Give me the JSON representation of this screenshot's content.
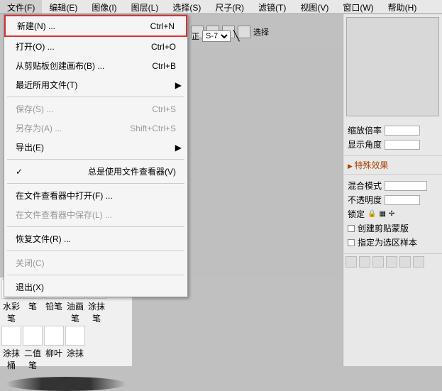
{
  "menubar": [
    {
      "label": "文件(F)"
    },
    {
      "label": "编辑(E)"
    },
    {
      "label": "图像(I)"
    },
    {
      "label": "图层(L)"
    },
    {
      "label": "选择(S)"
    },
    {
      "label": "尺子(R)"
    },
    {
      "label": "滤镜(T)"
    },
    {
      "label": "视图(V)"
    },
    {
      "label": "窗口(W)"
    },
    {
      "label": "帮助(H)"
    }
  ],
  "file_menu": {
    "new": {
      "label": "新建(N) ...",
      "shortcut": "Ctrl+N"
    },
    "open": {
      "label": "打开(O) ...",
      "shortcut": "Ctrl+O"
    },
    "clipboard": {
      "label": "从剪贴板创建画布(B) ...",
      "shortcut": "Ctrl+B"
    },
    "recent": {
      "label": "最近所用文件(T)"
    },
    "save": {
      "label": "保存(S) ...",
      "shortcut": "Ctrl+S"
    },
    "saveas": {
      "label": "另存为(A) ...",
      "shortcut": "Shift+Ctrl+S"
    },
    "export": {
      "label": "导出(E)"
    },
    "always_viewer": {
      "label": "总是使用文件查看器(V)"
    },
    "open_viewer": {
      "label": "在文件查看器中打开(F) ..."
    },
    "save_viewer": {
      "label": "在文件查看器中保存(L) ..."
    },
    "restore": {
      "label": "恢复文件(R) ..."
    },
    "close": {
      "label": "关闭(C)"
    },
    "exit": {
      "label": "退出(X)"
    }
  },
  "toolbar": {
    "select_label": "选择",
    "mode_label": "正",
    "seven_option": "S-7"
  },
  "right_panel": {
    "zoom_label": "缩放倍率",
    "angle_label": "显示角度",
    "effects_header": "特殊效果",
    "blend_label": "混合模式",
    "opacity_label": "不透明度",
    "lock_label": "锁定",
    "clip_label": "创建剪贴蒙版",
    "sample_label": "指定为选区样本"
  },
  "brushes": {
    "row1": [
      "水彩笔",
      "笔",
      "铅笔",
      "油画笔",
      "涂抹笔"
    ],
    "row2": [
      "涂抹桶",
      "二值笔",
      "柳叶",
      "涂抹"
    ]
  }
}
